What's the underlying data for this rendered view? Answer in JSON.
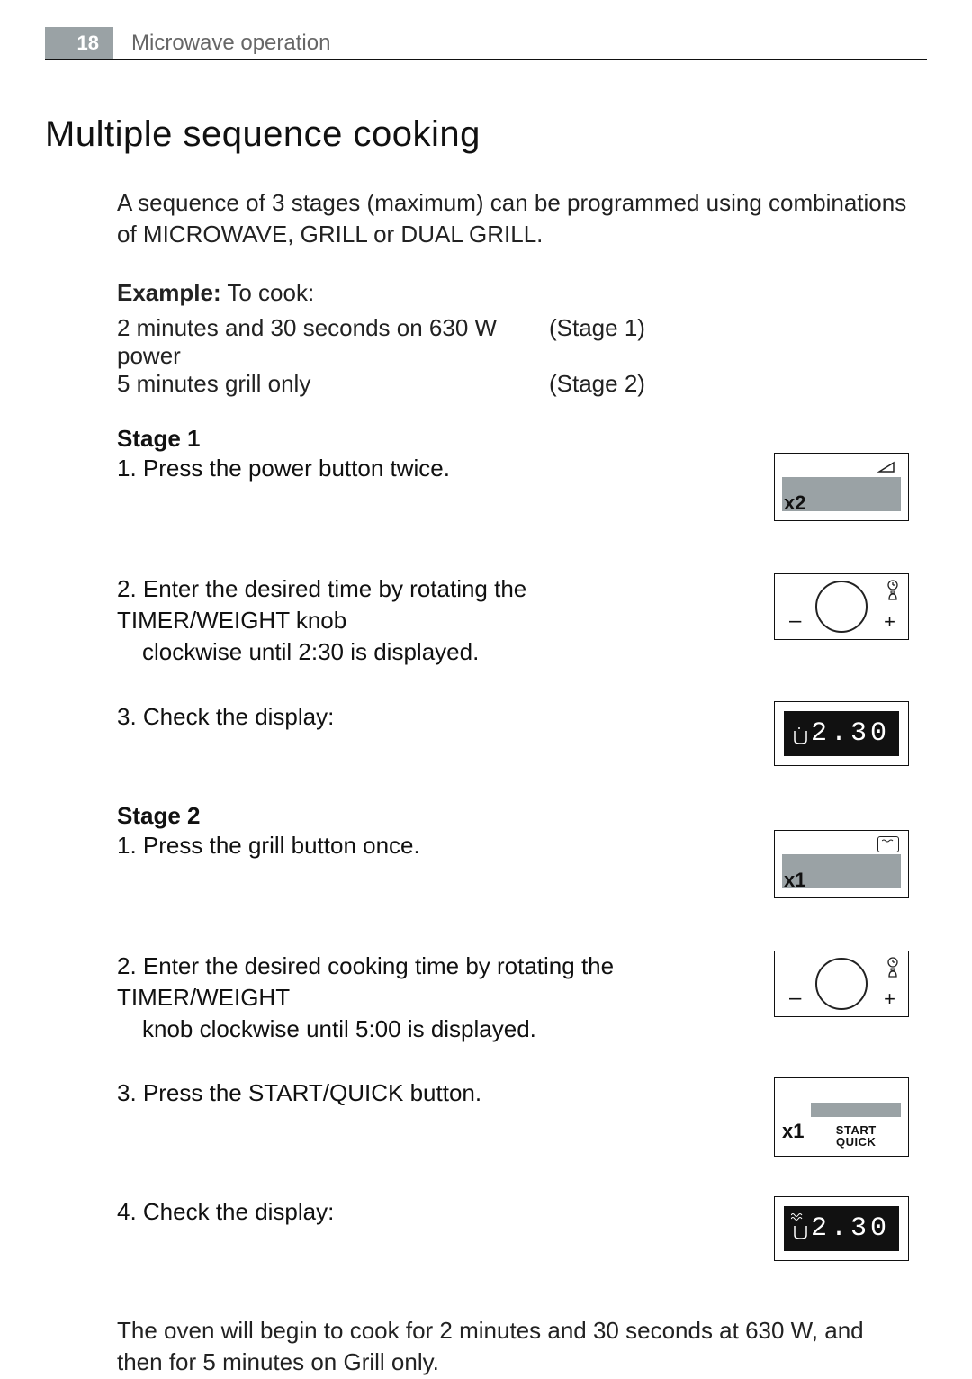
{
  "header": {
    "page_number": "18",
    "running_head": "Microwave operation"
  },
  "section_title": "Multiple sequence cooking",
  "intro": "A sequence of 3 stages (maximum) can be programmed using combinations of MICROWAVE, GRILL or DUAL GRILL.",
  "example": {
    "label": "Example:",
    "lead": " To cook:",
    "line1_left": "2 minutes and 30 seconds on 630 W power",
    "line1_right": "(Stage 1)",
    "line2_left": "5 minutes grill only",
    "line2_right": "(Stage 2)"
  },
  "stage1": {
    "heading": "Stage 1",
    "step1": "1. Press the power button twice.",
    "fig1_counter": "x2",
    "step2_a": "2. Enter the desired time by rotating the TIMER/WEIGHT knob",
    "step2_b": "clockwise until 2:30 is displayed.",
    "step3": "3. Check the display:",
    "display_value": "2.30"
  },
  "stage2": {
    "heading": "Stage 2",
    "step1": "1. Press the grill button once.",
    "fig1_counter": "x1",
    "step2_a": "2. Enter the desired cooking time by rotating the TIMER/WEIGHT",
    "step2_b": "knob clockwise until 5:00 is displayed.",
    "step3": "3. Press the START/QUICK button.",
    "sq_counter": "x1",
    "sq_label1": "START",
    "sq_label2": "QUICK",
    "step4": "4. Check the display:",
    "display_value": "2.30"
  },
  "closing": "The oven will begin to cook for 2 minutes and 30 seconds at 630 W, and then for 5 minutes on Grill only.",
  "glyphs": {
    "minus": "–",
    "plus": "+",
    "clock": "⊕",
    "weight": "⌥",
    "cup": "⌜"
  }
}
